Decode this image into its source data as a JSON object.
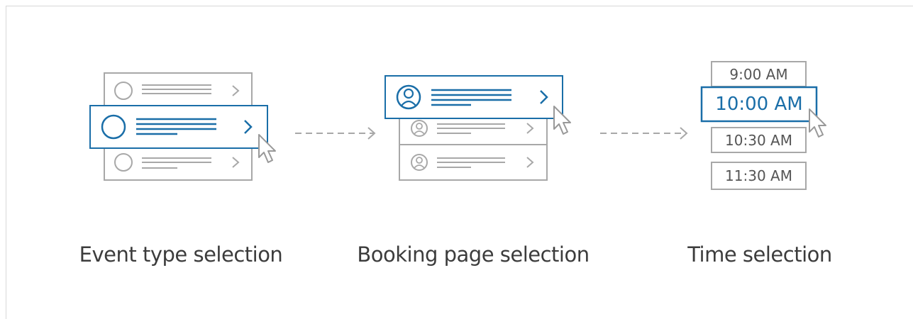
{
  "steps": [
    {
      "label": "Event type selection"
    },
    {
      "label": "Booking page selection"
    },
    {
      "label": "Time selection"
    }
  ],
  "time_slots": [
    "9:00 AM",
    "10:00 AM",
    "10:30 AM",
    "11:30 AM"
  ],
  "selected_time": "10:00 AM",
  "colors": {
    "accent": "#1a6ea8",
    "outline_gray": "#a8a8a8",
    "label_text": "#3c3c3c",
    "frame_border": "#d8d8d8"
  },
  "icons": [
    "circle-icon",
    "person-icon",
    "chevron-right-icon",
    "cursor-icon",
    "arrow-right-icon"
  ]
}
